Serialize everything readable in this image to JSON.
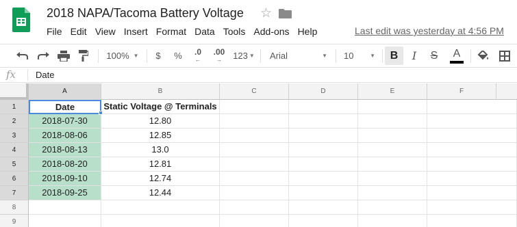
{
  "app": {
    "title": "2018 NAPA/Tacoma Battery Voltage",
    "last_edit": "Last edit was yesterday at 4:56 PM",
    "brand_color": "#0f9d58"
  },
  "menu": [
    "File",
    "Edit",
    "View",
    "Insert",
    "Format",
    "Data",
    "Tools",
    "Add-ons",
    "Help"
  ],
  "toolbar": {
    "zoom": "100%",
    "currency": "$",
    "percent": "%",
    "decrease_decimals": ".0",
    "increase_decimals": ".00",
    "more_formats": "123",
    "font": "Arial",
    "font_size": "10",
    "bold": "B",
    "italic": "I",
    "strike": "S",
    "text_color_label": "A",
    "text_color": "#000000",
    "icons": [
      "undo-icon",
      "redo-icon",
      "print-icon",
      "paint-format-icon",
      "fill-color-icon",
      "borders-icon"
    ]
  },
  "formula_bar": {
    "fx": "fx",
    "content": "Date"
  },
  "sheet": {
    "columns": [
      "A",
      "B",
      "C",
      "D",
      "E",
      "F"
    ],
    "rows": [
      "1",
      "2",
      "3",
      "4",
      "5",
      "6",
      "7",
      "8",
      "9"
    ],
    "header": [
      "Date",
      "Static Voltage @ Terminals"
    ],
    "data": [
      [
        "2018-07-30",
        "12.80"
      ],
      [
        "2018-08-06",
        "12.85"
      ],
      [
        "2018-08-13",
        "13.0"
      ],
      [
        "2018-08-20",
        "12.81"
      ],
      [
        "2018-09-10",
        "12.74"
      ],
      [
        "2018-09-25",
        "12.44"
      ]
    ],
    "selection_color": "#4a89dc",
    "highlight_color": "#b8dfca"
  }
}
